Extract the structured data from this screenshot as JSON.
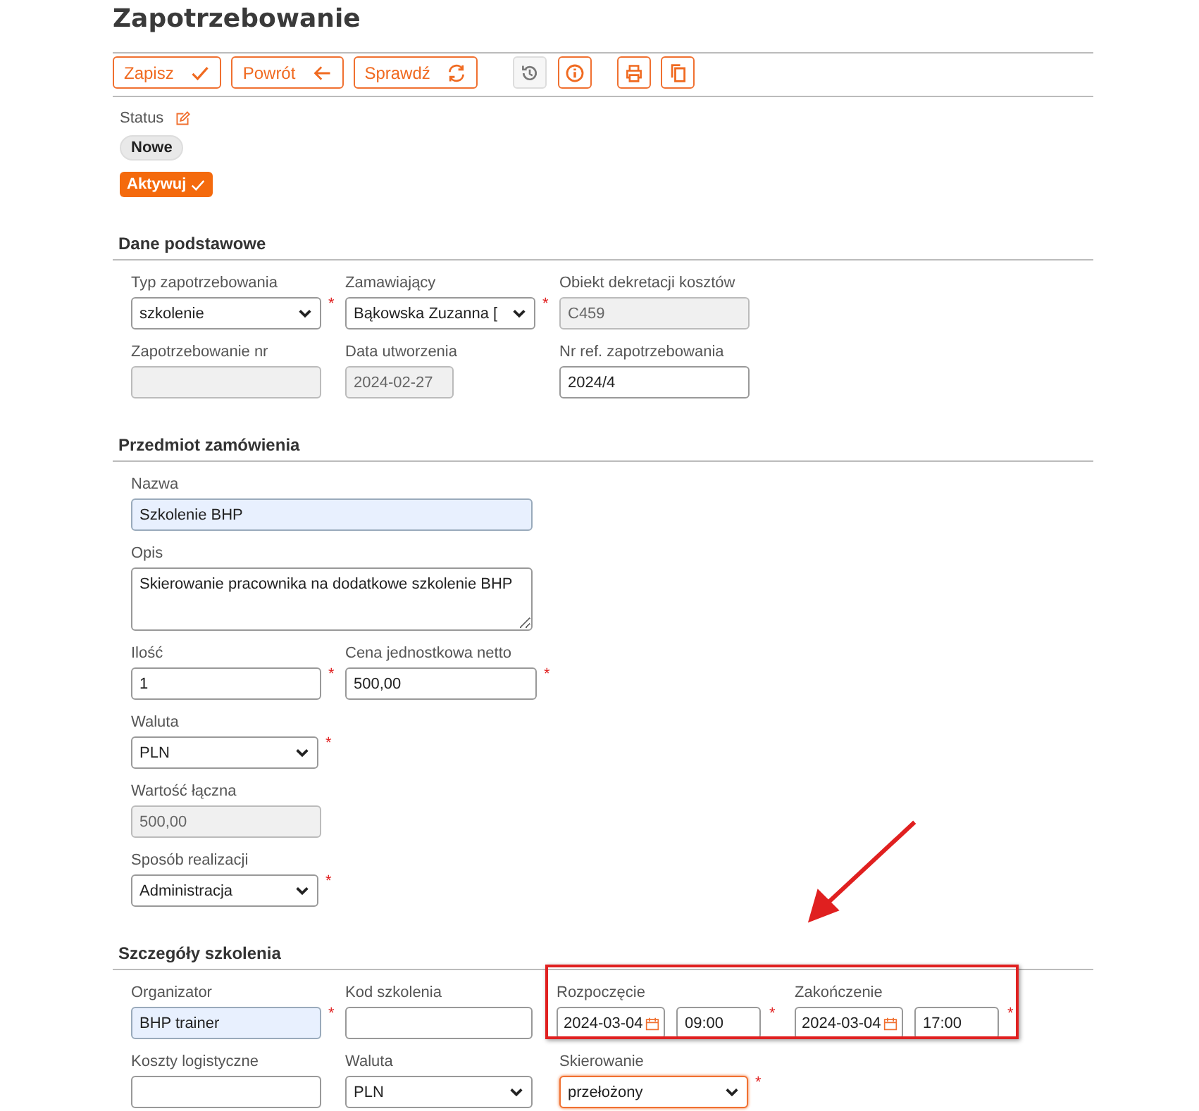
{
  "title": "Zapotrzebowanie",
  "toolbar": [
    {
      "buttons": [
        {
          "kind": "text",
          "label": "Zapisz",
          "disabled": false
        },
        {
          "kind": "text",
          "label": "Powrót",
          "disabled": false
        },
        {
          "kind": "text",
          "label": "Sprawdź",
          "disabled": false
        }
      ]
    },
    {
      "buttons": [
        {
          "kind": "icon",
          "disabled": true
        },
        {
          "kind": "icon",
          "disabled": false
        }
      ]
    },
    {
      "buttons": [
        {
          "kind": "icon",
          "disabled": false
        },
        {
          "kind": "icon",
          "disabled": false
        }
      ]
    }
  ],
  "status": {
    "label": "Status",
    "value": "Nowe",
    "actions": [
      {
        "label": "Aktywuj"
      }
    ]
  },
  "sections": [
    {
      "title": "Dane podstawowe",
      "rows": [
        [
          {
            "kind": "select",
            "label": "Typ zapotrzebowania",
            "value": "szkolenie",
            "required_mark": "*"
          },
          {
            "kind": "select",
            "label": "Zamawiający",
            "value": "Bąkowska Zuzanna [",
            "required_mark": "*"
          },
          {
            "kind": "text",
            "label": "Obiekt dekretacji kosztów",
            "value": "C459",
            "disabled": true
          }
        ],
        [
          {
            "kind": "text",
            "label": "Zapotrzebowanie nr",
            "disabled": true
          },
          {
            "kind": "text",
            "label": "Data utworzenia",
            "value": "2024-02-27",
            "disabled": true
          },
          {
            "kind": "text",
            "label": "Nr ref. zapotrzebowania",
            "value": "2024/4"
          }
        ]
      ]
    },
    {
      "title": "Przedmiot zamówienia",
      "rows": [
        [
          {
            "kind": "text",
            "label": "Nazwa",
            "value": "Szkolenie BHP",
            "highlighted": true
          }
        ],
        [
          {
            "kind": "textarea",
            "label": "Opis",
            "value": "Skierowanie pracownika na dodatkowe szkolenie BHP"
          }
        ],
        [
          {
            "kind": "text",
            "label": "Ilość",
            "value": "1",
            "required_mark": "*"
          },
          {
            "kind": "text",
            "label": "Cena jednostkowa netto",
            "value": "500,00",
            "required_mark": "*"
          }
        ],
        [
          {
            "kind": "select",
            "label": "Waluta",
            "value": "PLN",
            "required_mark": "*"
          }
        ],
        [
          {
            "kind": "text",
            "label": "Wartość łączna",
            "value": "500,00",
            "disabled": true
          }
        ],
        [
          {
            "kind": "select",
            "label": "Sposób realizacji",
            "value": "Administracja",
            "required_mark": "*"
          }
        ]
      ]
    },
    {
      "title": "Szczegóły szkolenia",
      "rows": [
        [
          {
            "kind": "text",
            "label": "Organizator",
            "value": "BHP trainer",
            "required_mark": "*",
            "highlighted": true
          },
          {
            "kind": "text",
            "label": "Kod szkolenia"
          },
          {
            "kind": "group",
            "annotated": true,
            "items": [
              {
                "label": "Rozpoczęcie",
                "date": "2024-03-04",
                "time": "09:00",
                "required_mark": "*"
              },
              {
                "label": "Zakończenie",
                "date": "2024-03-04",
                "time": "17:00",
                "required_mark": "*"
              }
            ]
          }
        ],
        [
          {
            "kind": "text",
            "label": "Koszty logistyczne"
          },
          {
            "kind": "select",
            "label": "Waluta",
            "value": "PLN"
          },
          {
            "kind": "select",
            "label": "Skierowanie",
            "value": "przełożony",
            "required_mark": "*",
            "focused": true
          }
        ]
      ]
    }
  ]
}
